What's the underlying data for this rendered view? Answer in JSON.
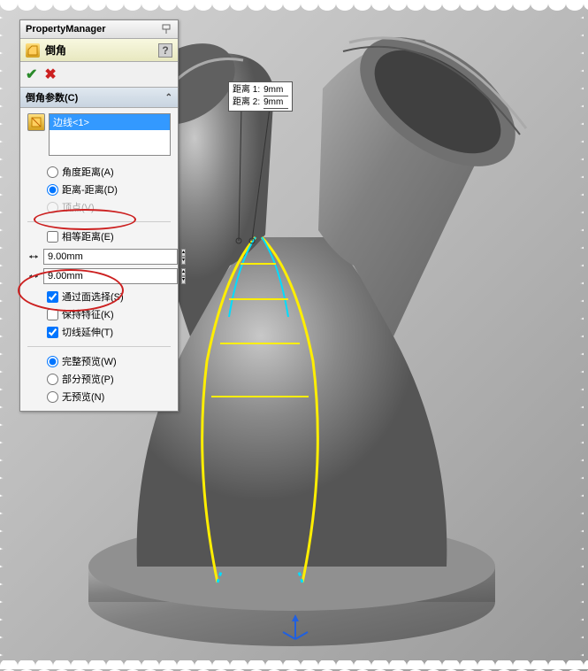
{
  "panel": {
    "header": "PropertyManager",
    "feature_title": "倒角",
    "help": "?"
  },
  "section": {
    "title": "倒角参数(C)"
  },
  "selection": {
    "item": "边线<1>"
  },
  "radios": {
    "angle_dist": "角度距离(A)",
    "dist_dist": "距离-距离(D)",
    "vertex": "顶点(V)"
  },
  "checks": {
    "equal_dist": "相等距离(E)",
    "face_sel": "通过面选择(S)",
    "keep_feat": "保持特征(K)",
    "tangent_prop": "切线延伸(T)"
  },
  "spinners": {
    "d1_label": "D1",
    "d1_value": "9.00mm",
    "d2_label": "D2",
    "d2_value": "9.00mm"
  },
  "preview": {
    "full": "完整预览(W)",
    "partial": "部分预览(P)",
    "none": "无预览(N)"
  },
  "callout": {
    "row1_label": "距离 1:",
    "row1_val": "9mm",
    "row2_label": "距离 2:",
    "row2_val": "9mm"
  }
}
